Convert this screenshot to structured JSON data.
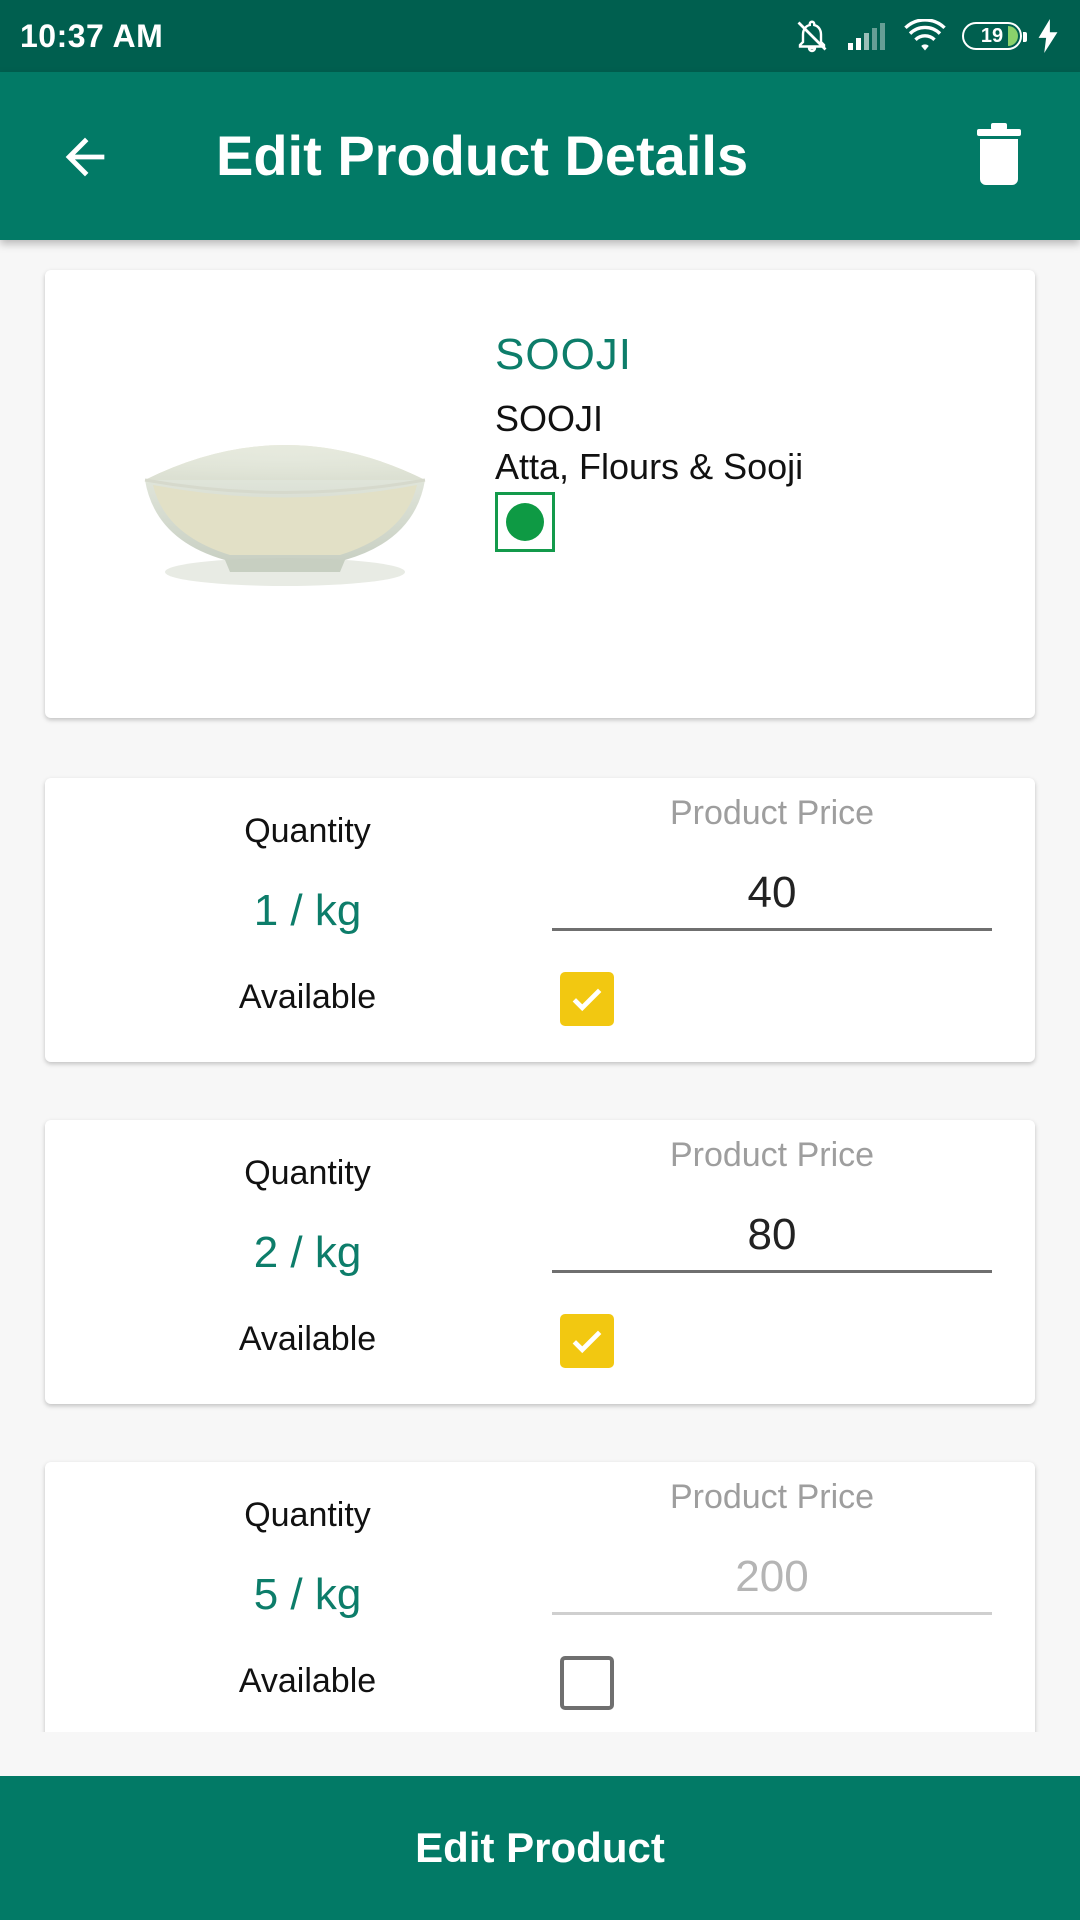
{
  "status_bar": {
    "time": "10:37 AM",
    "battery": "19",
    "icons": [
      "mute-icon",
      "signal-icon",
      "wifi-icon",
      "battery-icon",
      "charging-icon"
    ]
  },
  "app_bar": {
    "title": "Edit Product Details",
    "back_icon": "arrow-back-icon",
    "delete_icon": "trash-icon"
  },
  "product": {
    "name": "SOOJI",
    "subname": "SOOJI",
    "category": "Atta, Flours & Sooji",
    "veg_badge": "veg-indicator-icon",
    "image": "sooji-bowl-image"
  },
  "variants": [
    {
      "quantity_label": "Quantity",
      "quantity": "1 / kg",
      "price_label": "Product Price",
      "price": "40",
      "available_label": "Available",
      "available": true
    },
    {
      "quantity_label": "Quantity",
      "quantity": "2 / kg",
      "price_label": "Product Price",
      "price": "80",
      "available_label": "Available",
      "available": true
    },
    {
      "quantity_label": "Quantity",
      "quantity": "5 / kg",
      "price_label": "Product Price",
      "price": "200",
      "available_label": "Available",
      "available": false
    }
  ],
  "actions": {
    "edit_product": "Edit Product"
  },
  "colors": {
    "status_bar": "#005f4f",
    "primary": "#027a66",
    "accent_text": "#0d7d6a",
    "checkbox": "#f2c811",
    "veg": "#0e9a44"
  }
}
